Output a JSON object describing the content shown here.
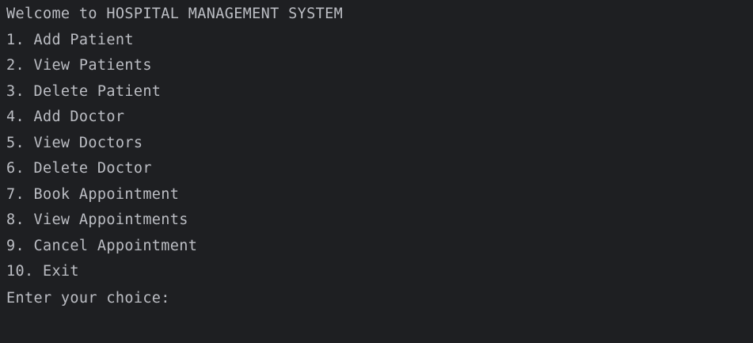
{
  "console": {
    "title_line": "Welcome to HOSPITAL MANAGEMENT SYSTEM",
    "menu": [
      "1. Add Patient",
      "2. View Patients",
      "3. Delete Patient",
      "4. Add Doctor",
      "5. View Doctors",
      "6. Delete Doctor",
      "7. Book Appointment",
      "8. View Appointments",
      "9. Cancel Appointment",
      "10. Exit"
    ],
    "prompt": "Enter your choice:",
    "input_value": ""
  },
  "colors": {
    "background": "#1e1f22",
    "text": "#bcbec4"
  }
}
